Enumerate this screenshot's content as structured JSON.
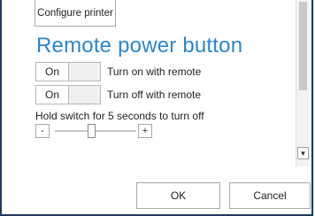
{
  "header": {
    "configure_label": "Configure printer"
  },
  "section": {
    "title": "Remote power button"
  },
  "toggles": [
    {
      "value": "On",
      "label": "Turn on with remote"
    },
    {
      "value": "On",
      "label": "Turn off with remote"
    }
  ],
  "hold": {
    "label": "Hold switch for 5 seconds to turn off",
    "minus": "-",
    "plus": "+",
    "slider_fraction": 0.45
  },
  "scrollbar": {
    "down_glyph": "▼"
  },
  "footer": {
    "ok_label": "OK",
    "cancel_label": "Cancel"
  }
}
